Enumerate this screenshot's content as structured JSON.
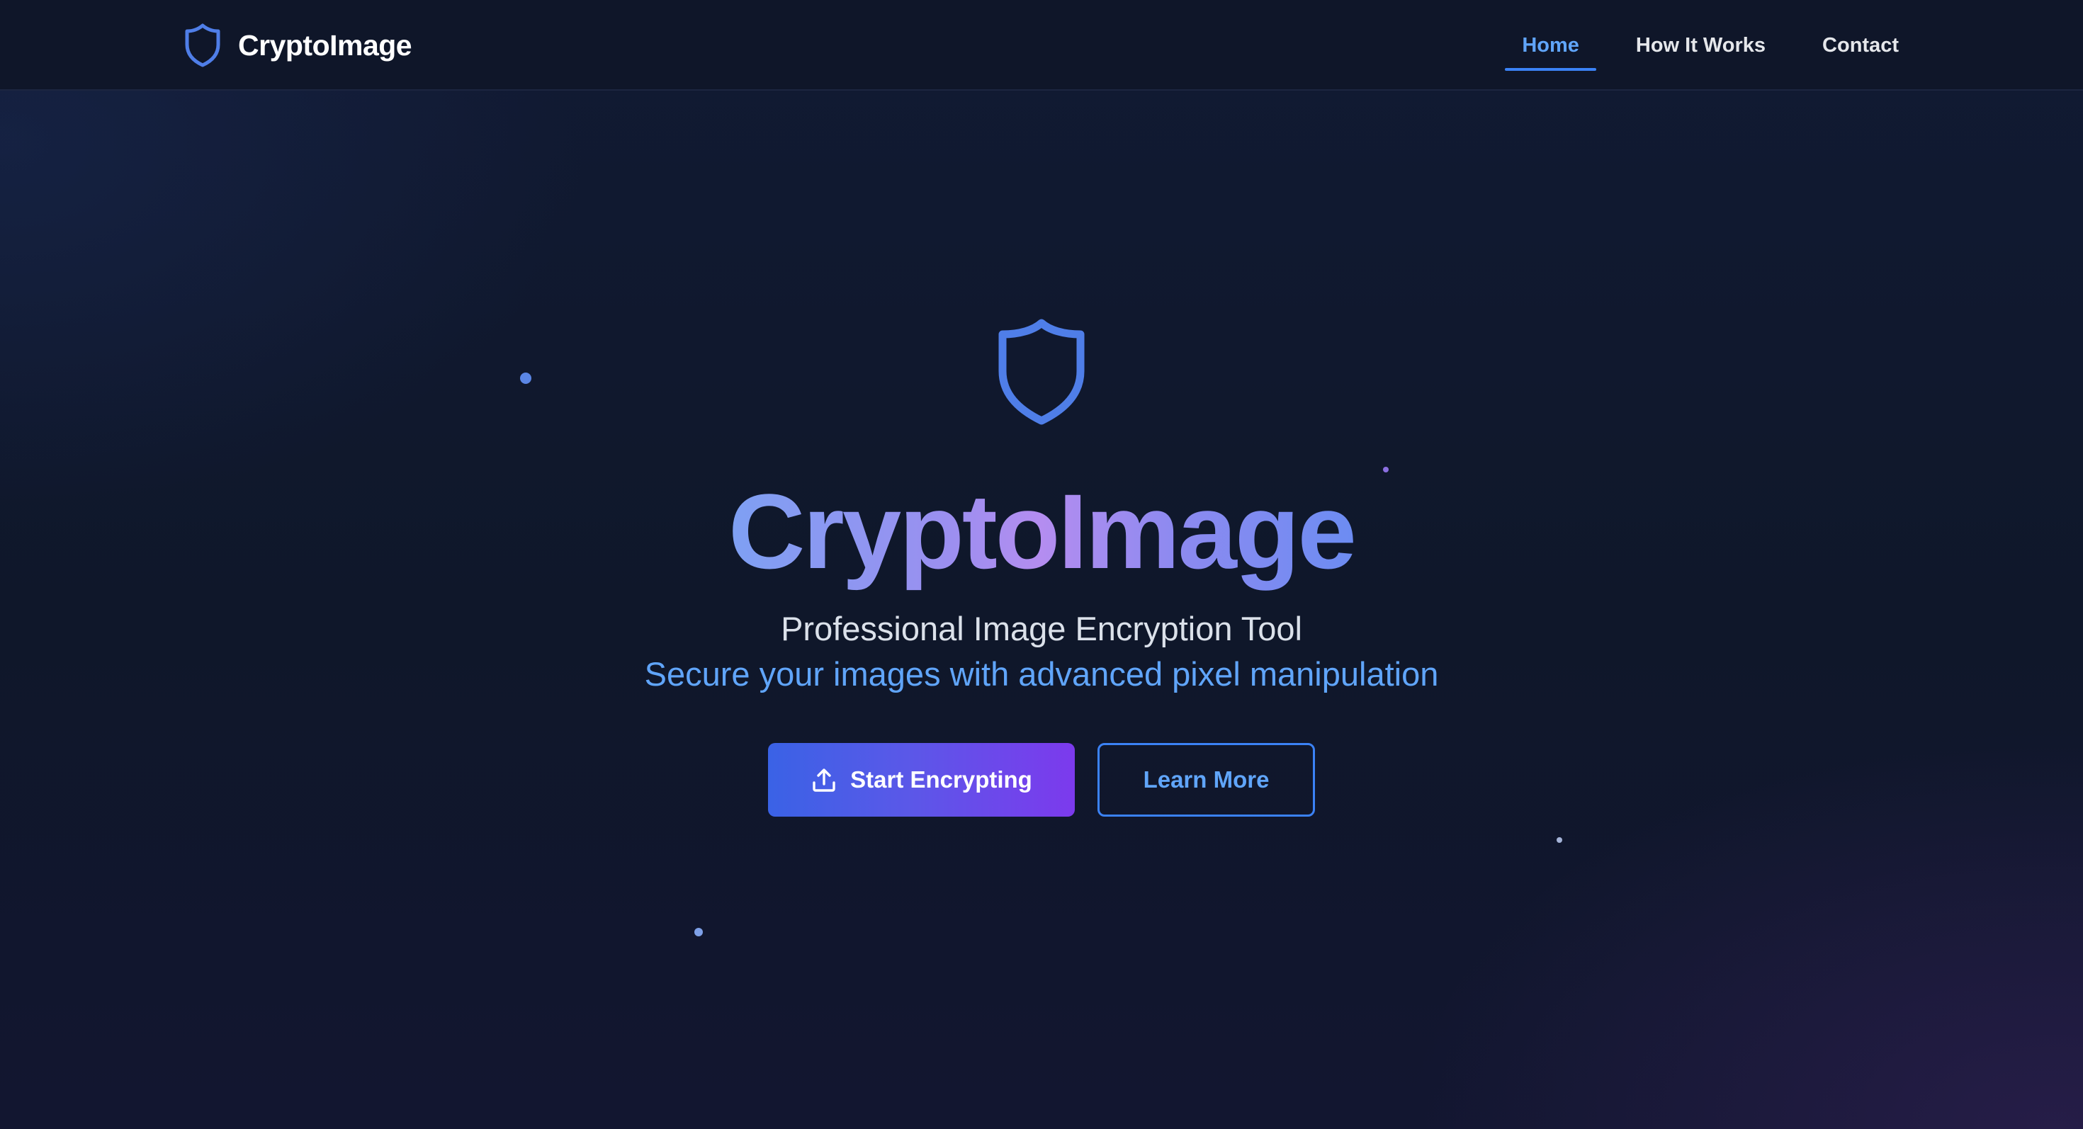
{
  "navbar": {
    "brand_name": "CryptoImage",
    "brand_icon": "shield-icon",
    "links": [
      {
        "label": "Home",
        "active": true
      },
      {
        "label": "How It Works",
        "active": false
      },
      {
        "label": "Contact",
        "active": false
      }
    ]
  },
  "hero": {
    "icon": "shield-icon",
    "title": "CryptoImage",
    "subtitle": "Professional Image Encryption Tool",
    "tagline": "Secure your images with advanced pixel manipulation",
    "primary_button": {
      "label": "Start Encrypting",
      "icon": "upload-icon"
    },
    "secondary_button": {
      "label": "Learn More"
    }
  },
  "colors": {
    "background": "#0f172a",
    "accent_blue": "#3b82f6",
    "accent_light_blue": "#60a5fa",
    "accent_purple": "#7c3aed",
    "text_primary": "#ffffff",
    "text_secondary": "#dbe1ea"
  }
}
